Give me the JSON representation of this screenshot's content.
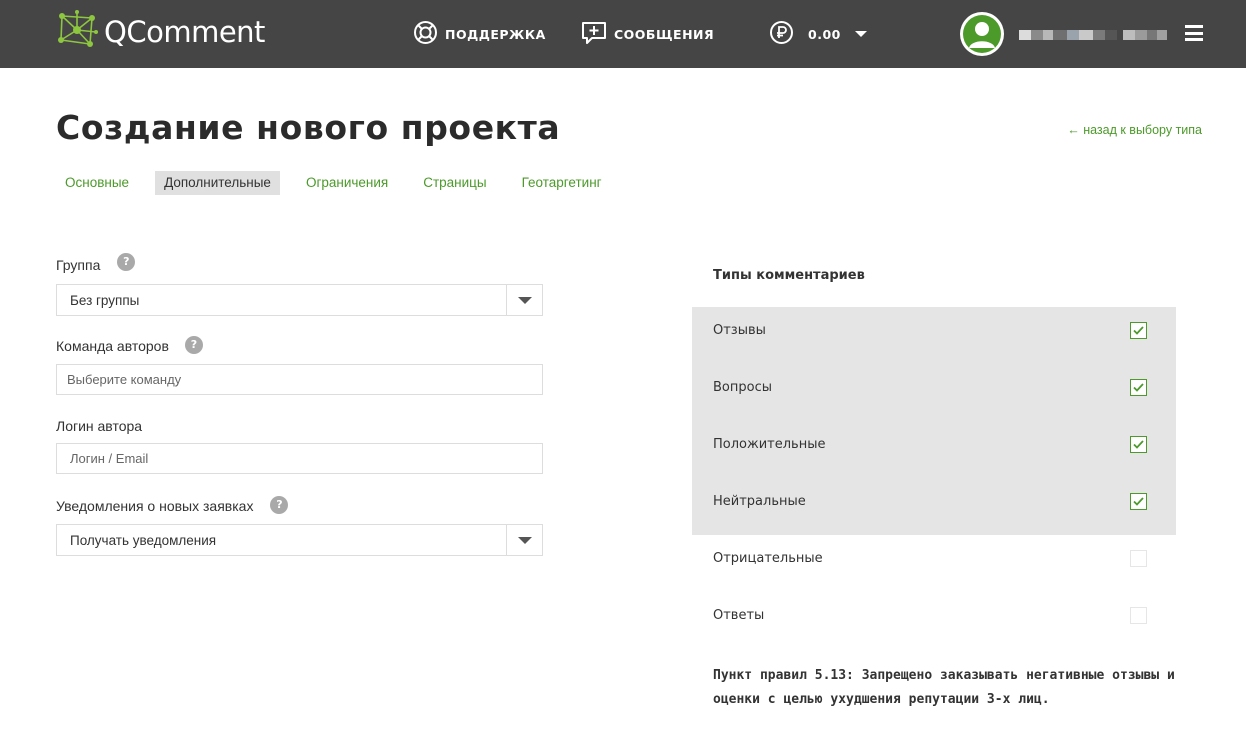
{
  "header": {
    "logo_text": "QComment",
    "support_label": "ПОДДЕРЖКА",
    "messages_label": "СООБЩЕНИЯ",
    "balance_value": "0.00",
    "icons": [
      "logo-molecule-icon",
      "lifebuoy-icon",
      "message-plus-icon",
      "ruble-coin-icon",
      "chevron-down-icon",
      "user-avatar-icon",
      "hamburger-menu-icon"
    ],
    "colors": {
      "bar": "#454545",
      "accent": "#4c9a2a"
    }
  },
  "page": {
    "title": "Создание нового проекта",
    "back_link": "← назад к выбору типа"
  },
  "tabs": [
    {
      "label": "Основные",
      "active": false
    },
    {
      "label": "Дополнительные",
      "active": true
    },
    {
      "label": "Ограничения",
      "active": false
    },
    {
      "label": "Страницы",
      "active": false
    },
    {
      "label": "Геотаргетинг",
      "active": false
    }
  ],
  "form": {
    "group_label": "Группа",
    "group_value": "Без группы",
    "team_label": "Команда авторов",
    "team_placeholder": "Выберите команду",
    "login_label": "Логин автора",
    "login_placeholder": "Логин / Email",
    "notify_label": "Уведомления о новых заявках",
    "notify_value": "Получать уведомления",
    "help_glyph": "?"
  },
  "comment_types": {
    "title": "Типы комментариев",
    "items": [
      {
        "label": "Отзывы",
        "checked": true
      },
      {
        "label": "Вопросы",
        "checked": true
      },
      {
        "label": "Положительные",
        "checked": true
      },
      {
        "label": "Нейтральные",
        "checked": true
      },
      {
        "label": "Отрицательные",
        "checked": false
      },
      {
        "label": "Ответы",
        "checked": false
      }
    ]
  },
  "rule_note": "Пункт правил 5.13: Запрещено заказывать негативные отзывы и оценки с целью ухудшения репутации 3-х лиц."
}
